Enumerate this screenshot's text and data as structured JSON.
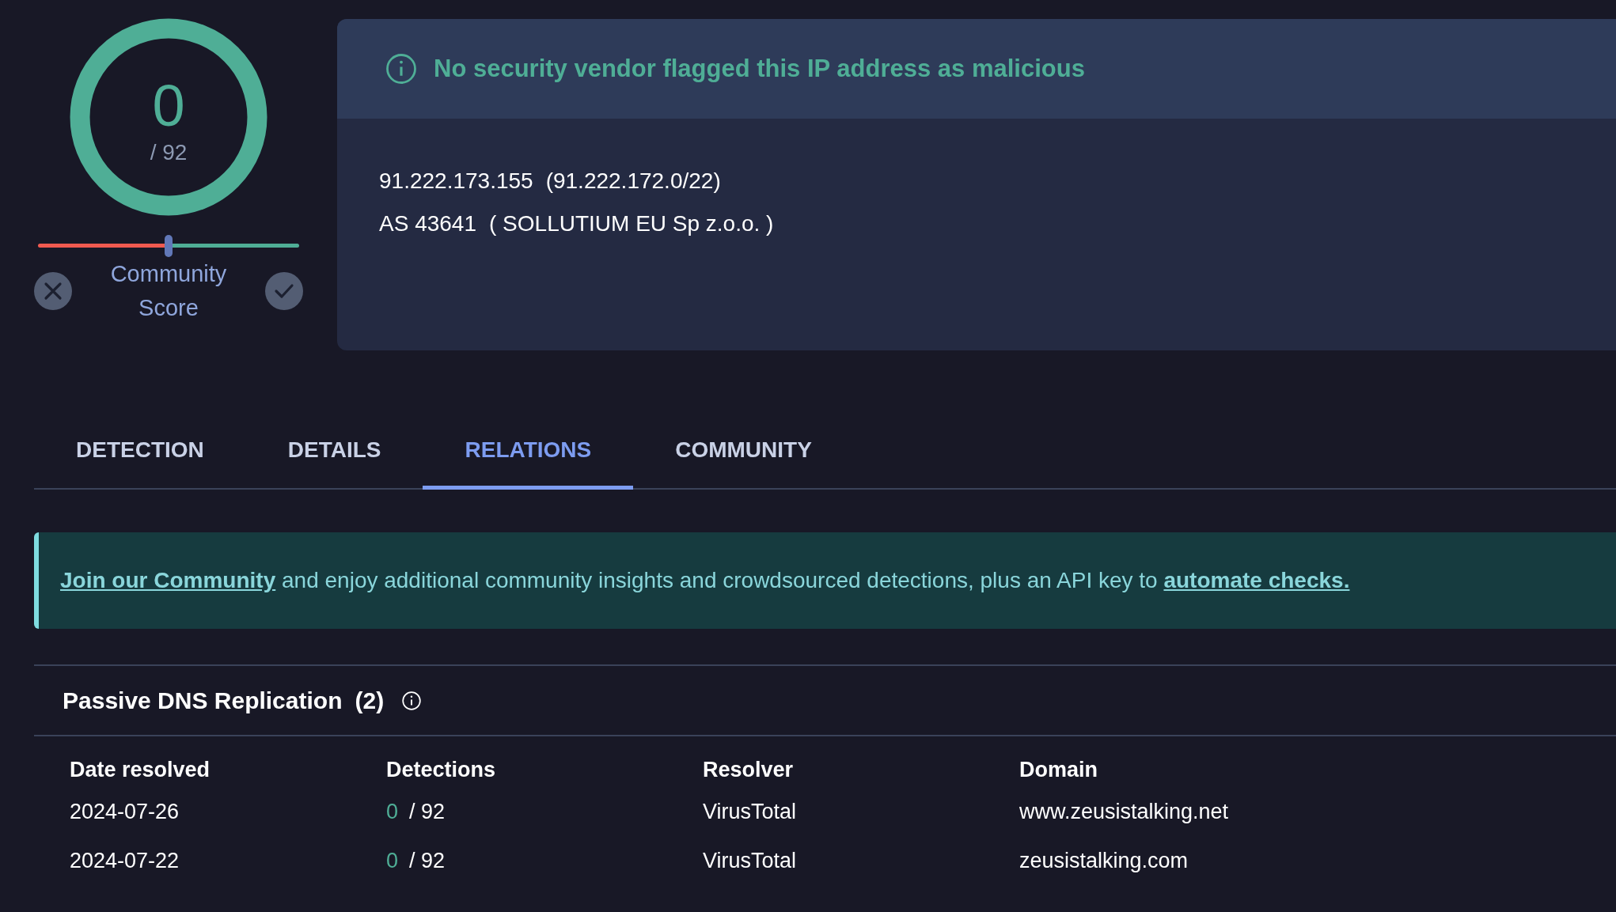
{
  "score": {
    "detections": "0",
    "total": "/ 92"
  },
  "community_score": {
    "label": "Community Score",
    "level": 0.5
  },
  "summary": {
    "message": "No security vendor flagged this IP address as malicious",
    "ip": "91.222.173.155",
    "range": "(91.222.172.0/22)",
    "asn": "AS 43641",
    "owner": "( SOLLUTIUM EU Sp z.o.o. )"
  },
  "tabs": [
    {
      "label": "DETECTION",
      "selected": false
    },
    {
      "label": "DETAILS",
      "selected": false
    },
    {
      "label": "RELATIONS",
      "selected": true
    },
    {
      "label": "COMMUNITY",
      "selected": false
    }
  ],
  "join_notice": [
    {
      "kind": "link",
      "text": "Join our Community"
    },
    {
      "kind": "text",
      "text": " and enjoy additional community insights and crowdsourced detections, plus an API key to "
    },
    {
      "kind": "link",
      "text": "automate checks."
    }
  ],
  "passive_dns": {
    "title": "Passive DNS Replication",
    "count": "(2)",
    "columns": [
      "Date resolved",
      "Detections",
      "Resolver",
      "Domain"
    ],
    "rows": [
      {
        "date": "2024-07-26",
        "detections": "0",
        "total": "/ 92",
        "resolver": "VirusTotal",
        "domain": "www.zeusistalking.net"
      },
      {
        "date": "2024-07-22",
        "detections": "0",
        "total": "/ 92",
        "resolver": "VirusTotal",
        "domain": "zeusistalking.com"
      }
    ]
  }
}
